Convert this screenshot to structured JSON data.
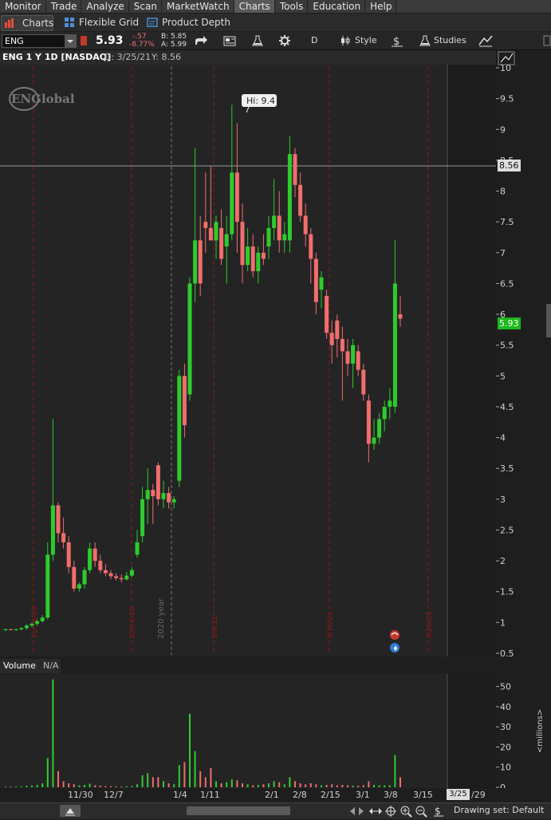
{
  "nav": [
    "Monitor",
    "Trade",
    "Analyze",
    "Scan",
    "MarketWatch",
    "Charts",
    "Tools",
    "Education",
    "Help"
  ],
  "nav_active": 5,
  "subtabs": {
    "charts": "Charts",
    "flexible": "Flexible Grid",
    "depth": "Product Depth"
  },
  "toolbar": {
    "symbol": "ENG",
    "price": "5.93",
    "change": "-.57",
    "change_pct": "-8.77%",
    "bid": "B: 5.85",
    "ask": "A: 5.99",
    "period": "D",
    "style": "Style",
    "studies": "Studies"
  },
  "chart_header": {
    "title": "ENG 1 Y 1D [NASDAQ]",
    "date": "D: 3/25/21",
    "yval": "Y: 8.56"
  },
  "logo_text": "ENGlobal",
  "hi_label": "Hi: 9.4",
  "crosshair_label": "8.56",
  "price_label": "5.93",
  "year_label": "2020 year",
  "colors": {
    "up": "#2ecc2e",
    "down": "#f26d6d",
    "bg": "#1e1e1e",
    "grid": "#8b1a1a"
  },
  "volume": {
    "title": "Volume",
    "value": "N/A",
    "unit": "<millions>"
  },
  "bottom": {
    "drawing": "Drawing set: Default",
    "cursor_date": "3/25"
  },
  "chart_data": {
    "type": "candlestick",
    "ylim": [
      0.5,
      10
    ],
    "y_ticks": [
      "10",
      "9.5",
      "9",
      "8.5",
      "8",
      "7.5",
      "7",
      "6.5",
      "6",
      "5.5",
      "5",
      "4.5",
      "4",
      "3.5",
      "3",
      "2.5",
      "2",
      "1.5",
      "1",
      "0.5"
    ],
    "x_ticks": [
      "11/30",
      "12/7",
      "1/4",
      "1/11",
      "2/1",
      "2/8",
      "2/15",
      "3/1",
      "3/8",
      "3/15",
      "/29"
    ],
    "vol_ticks": [
      "50",
      "40",
      "30",
      "20",
      "10",
      "0"
    ],
    "vol_ylim": [
      0,
      55
    ],
    "event_labels": [
      "11/19/20",
      "12/16/20",
      "1/6/21",
      "2/16/21",
      "3/26/21"
    ],
    "candles": [
      [
        0.88,
        0.9,
        0.86,
        0.89
      ],
      [
        0.89,
        0.9,
        0.87,
        0.88
      ],
      [
        0.88,
        0.9,
        0.86,
        0.89
      ],
      [
        0.89,
        0.92,
        0.87,
        0.91
      ],
      [
        0.91,
        0.97,
        0.88,
        0.95
      ],
      [
        0.95,
        1.0,
        0.92,
        0.98
      ],
      [
        0.98,
        1.05,
        0.95,
        1.02
      ],
      [
        1.02,
        1.12,
        1.0,
        1.08
      ],
      [
        1.08,
        2.3,
        1.05,
        2.1
      ],
      [
        2.1,
        4.3,
        2.0,
        2.9
      ],
      [
        2.9,
        2.95,
        2.3,
        2.45
      ],
      [
        2.45,
        2.7,
        2.2,
        2.3
      ],
      [
        2.3,
        2.4,
        1.8,
        1.9
      ],
      [
        1.9,
        2.0,
        1.5,
        1.55
      ],
      [
        1.55,
        1.65,
        1.5,
        1.62
      ],
      [
        1.62,
        1.9,
        1.55,
        1.85
      ],
      [
        1.85,
        2.3,
        1.8,
        2.2
      ],
      [
        2.2,
        2.3,
        1.9,
        2.0
      ],
      [
        2.0,
        2.1,
        1.8,
        1.85
      ],
      [
        1.85,
        1.95,
        1.75,
        1.8
      ],
      [
        1.8,
        1.85,
        1.7,
        1.75
      ],
      [
        1.75,
        1.8,
        1.68,
        1.72
      ],
      [
        1.72,
        1.78,
        1.65,
        1.7
      ],
      [
        1.7,
        1.82,
        1.68,
        1.76
      ],
      [
        1.76,
        1.9,
        1.74,
        1.85
      ],
      [
        2.1,
        2.5,
        2.05,
        2.3
      ],
      [
        2.4,
        3.2,
        2.3,
        3.0
      ],
      [
        3.0,
        3.5,
        2.6,
        3.15
      ],
      [
        3.15,
        3.25,
        2.6,
        3.05
      ],
      [
        3.55,
        3.6,
        2.9,
        3.0
      ],
      [
        3.0,
        3.3,
        2.85,
        3.1
      ],
      [
        3.1,
        3.2,
        2.85,
        2.95
      ],
      [
        2.95,
        3.05,
        2.85,
        3.0
      ],
      [
        3.3,
        5.1,
        3.2,
        5.0
      ],
      [
        5.0,
        5.2,
        4.0,
        4.2
      ],
      [
        4.7,
        6.6,
        4.6,
        6.5
      ],
      [
        6.5,
        8.7,
        6.2,
        7.2
      ],
      [
        7.2,
        7.6,
        6.3,
        6.5
      ],
      [
        7.5,
        8.3,
        7.0,
        7.4
      ],
      [
        7.4,
        8.4,
        7.2,
        7.2
      ],
      [
        7.2,
        7.6,
        6.9,
        7.5
      ],
      [
        7.4,
        7.7,
        6.8,
        6.9
      ],
      [
        7.1,
        7.6,
        6.5,
        7.3
      ],
      [
        7.3,
        9.4,
        7.2,
        8.3
      ],
      [
        8.3,
        9.1,
        7.0,
        7.5
      ],
      [
        7.5,
        7.8,
        6.5,
        6.8
      ],
      [
        6.8,
        7.4,
        6.7,
        7.1
      ],
      [
        7.1,
        7.3,
        6.6,
        6.7
      ],
      [
        6.7,
        7.1,
        6.5,
        7.0
      ],
      [
        7.0,
        7.3,
        6.8,
        6.9
      ],
      [
        7.1,
        7.6,
        6.9,
        7.4
      ],
      [
        7.4,
        8.2,
        7.2,
        7.6
      ],
      [
        7.6,
        8.0,
        7.0,
        7.2
      ],
      [
        7.2,
        7.5,
        7.0,
        7.3
      ],
      [
        7.2,
        8.9,
        7.0,
        8.6
      ],
      [
        8.6,
        8.7,
        7.9,
        8.1
      ],
      [
        8.1,
        8.3,
        7.5,
        7.6
      ],
      [
        7.6,
        7.8,
        7.1,
        7.3
      ],
      [
        7.3,
        7.4,
        6.5,
        6.9
      ],
      [
        6.9,
        7.0,
        6.0,
        6.2
      ],
      [
        6.4,
        6.7,
        6.1,
        6.6
      ],
      [
        6.3,
        6.4,
        5.6,
        5.7
      ],
      [
        5.7,
        5.9,
        5.2,
        5.5
      ],
      [
        5.9,
        6.0,
        5.3,
        5.6
      ],
      [
        5.6,
        5.8,
        4.6,
        5.4
      ],
      [
        5.4,
        5.6,
        5.0,
        5.2
      ],
      [
        5.2,
        5.6,
        4.8,
        5.5
      ],
      [
        5.4,
        5.5,
        5.0,
        5.1
      ],
      [
        5.1,
        5.2,
        4.6,
        4.7
      ],
      [
        4.6,
        4.7,
        3.6,
        3.9
      ],
      [
        3.9,
        4.3,
        3.8,
        4.0
      ],
      [
        4.0,
        4.4,
        3.9,
        4.3
      ],
      [
        4.3,
        4.6,
        4.1,
        4.5
      ],
      [
        4.5,
        4.8,
        4.3,
        4.6
      ],
      [
        4.5,
        7.2,
        4.4,
        6.5
      ],
      [
        6.0,
        6.3,
        5.8,
        5.93
      ]
    ],
    "volumes": [
      0.4,
      0.3,
      0.4,
      0.5,
      0.8,
      0.9,
      1.2,
      2.0,
      14.5,
      53.5,
      8.0,
      3.0,
      2.0,
      1.5,
      1.0,
      1.2,
      1.8,
      1.0,
      0.8,
      0.6,
      0.5,
      0.5,
      0.4,
      0.5,
      0.6,
      1.5,
      6.0,
      7.0,
      5.0,
      5.0,
      3.0,
      2.0,
      1.5,
      11.0,
      12.5,
      36.5,
      18.0,
      8.0,
      5.0,
      9.5,
      3.0,
      2.0,
      2.5,
      4.0,
      3.5,
      2.0,
      1.5,
      1.0,
      1.2,
      1.5,
      2.0,
      3.0,
      2.5,
      1.5,
      5.0,
      3.0,
      2.0,
      1.5,
      2.0,
      1.5,
      1.0,
      1.2,
      1.5,
      1.0,
      1.2,
      1.0,
      0.8,
      0.8,
      1.0,
      3.0,
      1.2,
      1.0,
      1.0,
      1.0,
      16.0,
      5.0
    ]
  }
}
